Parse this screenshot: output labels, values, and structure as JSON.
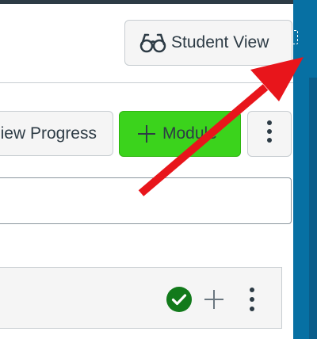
{
  "header": {
    "student_view_label": "Student View",
    "student_view_icon": "glasses-icon"
  },
  "toolbar": {
    "view_progress_label": "iew Progress",
    "add_module_label": "Module",
    "add_module_icon": "plus-icon",
    "more_options_icon": "kebab-menu-icon"
  },
  "module_row": {
    "status_icon": "published-check-icon",
    "add_item_icon": "plus-icon",
    "more_options_icon": "kebab-menu-icon"
  },
  "colors": {
    "module_button": "#3bd31c",
    "published": "#127a1b",
    "right_tray": "#0770a3",
    "annotation_arrow": "#e8151b"
  }
}
